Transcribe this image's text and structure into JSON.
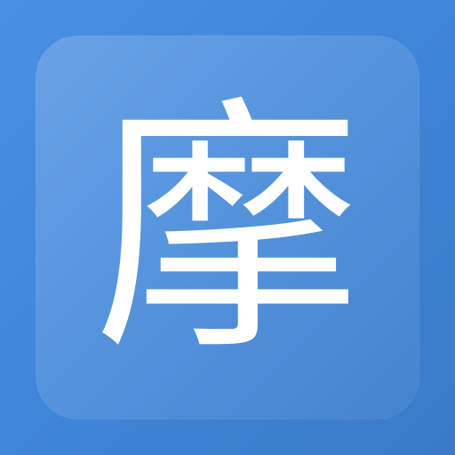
{
  "app_icon": {
    "glyph": "摩",
    "background_color": "#4a90e2",
    "tile_color": "rgba(255,255,255,0.14)",
    "glyph_color": "#ffffff"
  }
}
